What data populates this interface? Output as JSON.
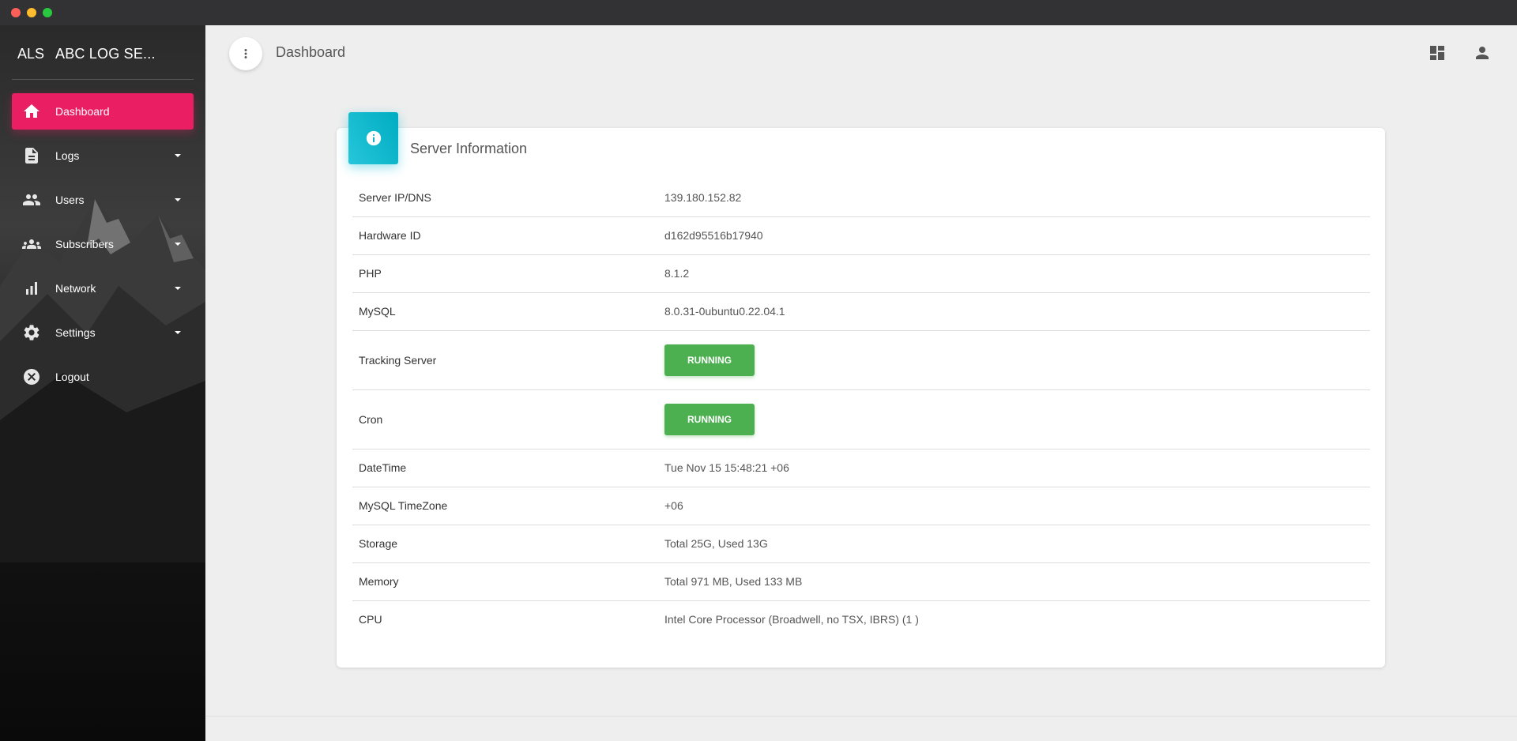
{
  "app": {
    "brand_abbr": "ALS",
    "brand_name": "ABC LOG SE..."
  },
  "sidebar": {
    "items": [
      {
        "label": "Dashboard",
        "icon": "home-icon",
        "active": true
      },
      {
        "label": "Logs",
        "icon": "document-icon",
        "has_submenu": true
      },
      {
        "label": "Users",
        "icon": "people-icon",
        "has_submenu": true
      },
      {
        "label": "Subscribers",
        "icon": "groups-icon",
        "has_submenu": true
      },
      {
        "label": "Network",
        "icon": "bar-chart-icon",
        "has_submenu": true
      },
      {
        "label": "Settings",
        "icon": "gear-icon",
        "has_submenu": true
      },
      {
        "label": "Logout",
        "icon": "close-circle-icon"
      }
    ]
  },
  "header": {
    "title": "Dashboard",
    "icons": [
      "more-vert-icon",
      "dashboard-icon",
      "person-icon"
    ]
  },
  "card": {
    "title": "Server Information",
    "icon": "info-icon",
    "rows": [
      {
        "label": "Server IP/DNS",
        "value": "139.180.152.82"
      },
      {
        "label": "Hardware ID",
        "value": "d162d95516b17940"
      },
      {
        "label": "PHP",
        "value": "8.1.2"
      },
      {
        "label": "MySQL",
        "value": "8.0.31-0ubuntu0.22.04.1"
      },
      {
        "label": "Tracking Server",
        "value": "RUNNING"
      },
      {
        "label": "Cron",
        "value": "RUNNING"
      },
      {
        "label": "DateTime",
        "value": "Tue Nov 15 15:48:21 +06"
      },
      {
        "label": "MySQL TimeZone",
        "value": "+06"
      },
      {
        "label": "Storage",
        "value": "Total 25G, Used 13G"
      },
      {
        "label": "Memory",
        "value": "Total 971 MB, Used 133 MB"
      },
      {
        "label": "CPU",
        "value": "Intel Core Processor (Broadwell, no TSX, IBRS) (1 )"
      }
    ]
  },
  "colors": {
    "accent": "#e91e63",
    "info": "#00bcd4",
    "running": "#4caf50"
  }
}
